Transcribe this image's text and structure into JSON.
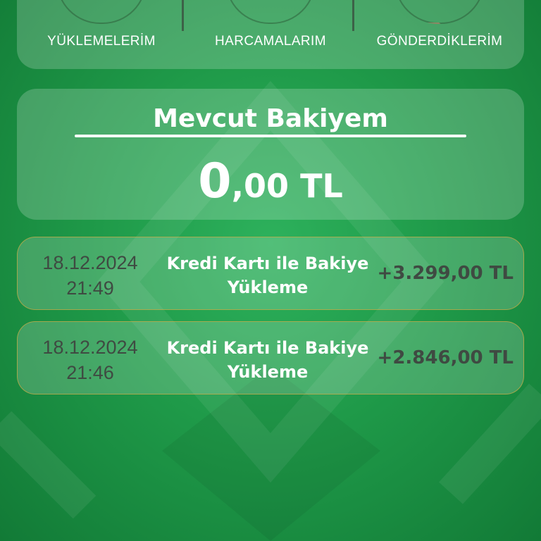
{
  "nav": {
    "items": [
      {
        "label": "YÜKLEMELERİM",
        "icon": "wallet-icon"
      },
      {
        "label": "HARCAMALARIM",
        "icon": "card-icon"
      },
      {
        "label": "GÖNDERDİKLERİM",
        "icon": "send-money-icon"
      }
    ]
  },
  "balance": {
    "title": "Mevcut Bakiyem",
    "amount_int": "0",
    "amount_frac": ",00 TL"
  },
  "transactions": [
    {
      "date": "18.12.2024",
      "time": "21:49",
      "description": "Kredi Kartı ile Bakiye Yükleme",
      "amount": "+3.299,00 TL"
    },
    {
      "date": "18.12.2024",
      "time": "21:46",
      "description": "Kredi Kartı ile Bakiye Yükleme",
      "amount": "+2.846,00 TL"
    }
  ],
  "colors": {
    "background": "#1f9a49",
    "card": "rgba(255,255,255,0.20)",
    "tx_border": "#c4aa46",
    "muted_text": "#3f4a42"
  }
}
